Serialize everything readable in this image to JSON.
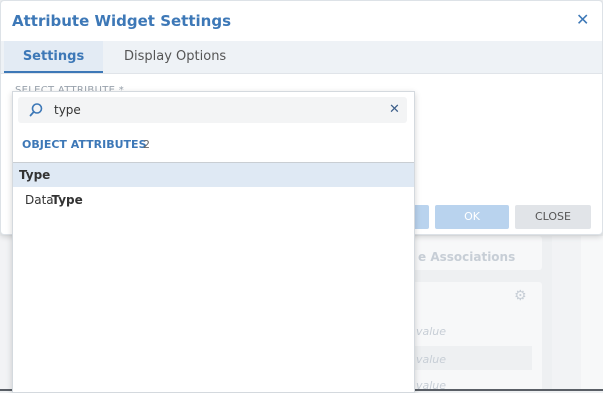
{
  "modal": {
    "title": "Attribute Widget Settings",
    "tabs": [
      {
        "label": "Settings",
        "active": true
      },
      {
        "label": "Display Options",
        "active": false
      }
    ],
    "field_label": "SELECT ATTRIBUTE",
    "buttons": {
      "ok": "OK",
      "close": "CLOSE"
    }
  },
  "dropdown": {
    "search_value": "type",
    "group_header": "OBJECT ATTRIBUTES",
    "group_count": "2",
    "options": [
      {
        "prefix": "",
        "match": "Type",
        "selected": true
      },
      {
        "prefix": "Data ",
        "match": "Type",
        "selected": false
      }
    ]
  },
  "background": {
    "associations_label": "e Associations",
    "value_label": "value"
  },
  "colors": {
    "accent": "#3d78b7",
    "selected_row": "#dfe9f4"
  }
}
